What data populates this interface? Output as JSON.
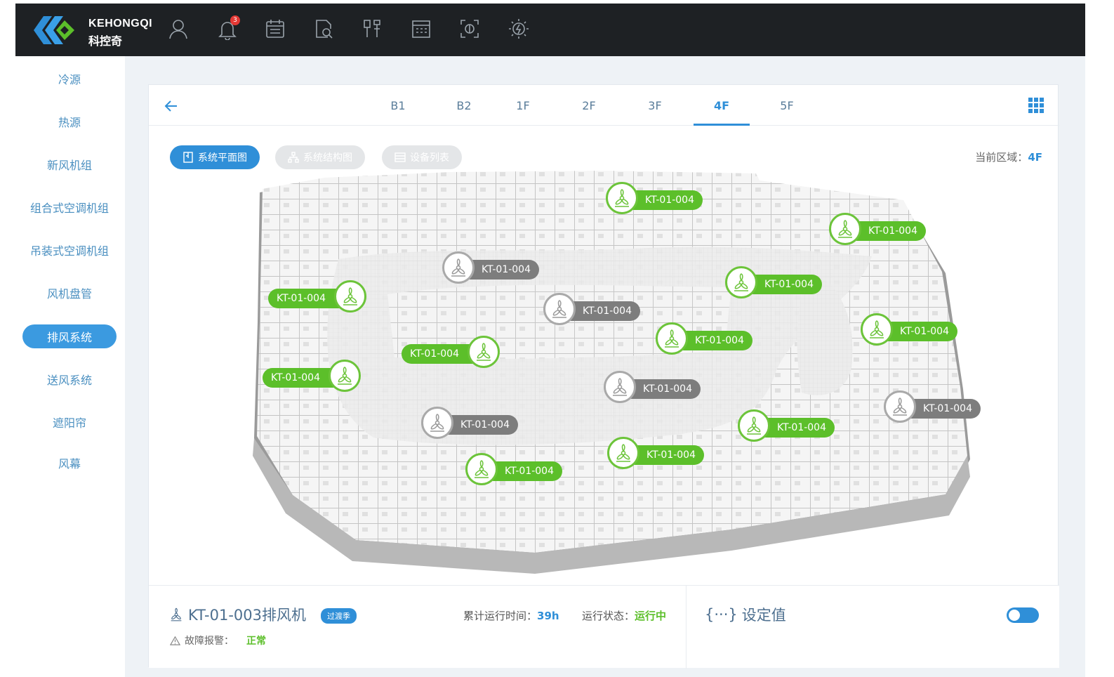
{
  "brand": {
    "name_en": "KEHONGQI",
    "name_cn": "科控奇",
    "colors": {
      "dark": "#1e2124",
      "blue": "#2f8fd8",
      "green": "#5cbf2a",
      "gray": "#7d7d7d"
    }
  },
  "topbar": {
    "icons": [
      "user-icon",
      "bell-icon",
      "calendar-icon",
      "document-search-icon",
      "tools-icon",
      "schedule-icon",
      "scan-icon",
      "energy-icon"
    ],
    "notification_count": "3"
  },
  "sidebar": {
    "items": [
      {
        "label": "冷源"
      },
      {
        "label": "热源"
      },
      {
        "label": "新风机组"
      },
      {
        "label": "组合式空调机组"
      },
      {
        "label": "吊装式空调机组"
      },
      {
        "label": "风机盘管"
      },
      {
        "label": "排风系统",
        "active": true
      },
      {
        "label": "送风系统"
      },
      {
        "label": "遮阳帘"
      },
      {
        "label": "风幕"
      }
    ]
  },
  "floors": {
    "tabs": [
      "B1",
      "B2",
      "1F",
      "2F",
      "3F",
      "4F",
      "5F"
    ],
    "active": "4F"
  },
  "views": {
    "plan": "系统平面图",
    "structure": "系统结构图",
    "list": "设备列表"
  },
  "region": {
    "label": "当前区域：",
    "value": "4F"
  },
  "markers": [
    {
      "label": "KT-01-004",
      "state": "running"
    },
    {
      "label": "KT-01-004",
      "state": "running"
    },
    {
      "label": "KT-01-004",
      "state": "stopped"
    },
    {
      "label": "KT-01-004",
      "state": "running"
    },
    {
      "label": "KT-01-004",
      "state": "running"
    },
    {
      "label": "KT-01-004",
      "state": "stopped"
    },
    {
      "label": "KT-01-004",
      "state": "running"
    },
    {
      "label": "KT-01-004",
      "state": "running"
    },
    {
      "label": "KT-01-004",
      "state": "running"
    },
    {
      "label": "KT-01-004",
      "state": "running"
    },
    {
      "label": "KT-01-004",
      "state": "stopped"
    },
    {
      "label": "KT-01-004",
      "state": "stopped"
    },
    {
      "label": "KT-01-004",
      "state": "stopped"
    },
    {
      "label": "KT-01-004",
      "state": "running"
    },
    {
      "label": "KT-01-004",
      "state": "running"
    },
    {
      "label": "KT-01-004",
      "state": "running"
    }
  ],
  "device": {
    "name": "KT-01-003排风机",
    "season": "过渡季",
    "runtime_label": "累计运行时间：",
    "runtime_value": "39h",
    "state_label": "运行状态：",
    "state_value": "运行中",
    "fault_label": "故障报警：",
    "fault_value": "正常"
  },
  "settings": {
    "title": "设定值",
    "icon": "{···}",
    "toggle_on": true
  }
}
